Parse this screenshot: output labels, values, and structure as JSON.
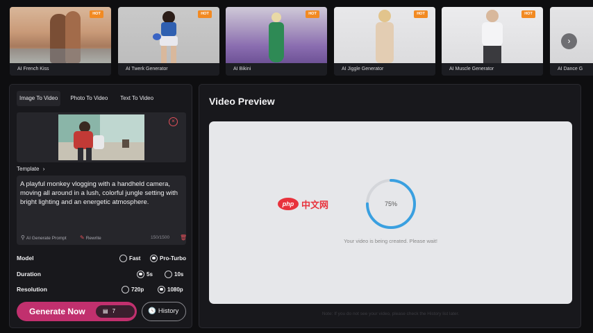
{
  "carousel": {
    "cards": [
      {
        "label": "AI French Kiss",
        "badge": "HOT"
      },
      {
        "label": "AI Twerk Generator",
        "badge": "HOT"
      },
      {
        "label": "AI Bikini",
        "badge": "HOT"
      },
      {
        "label": "AI Jiggle Generator",
        "badge": "HOT"
      },
      {
        "label": "AI Muscle Generator",
        "badge": "HOT"
      },
      {
        "label": "AI Dance G"
      }
    ],
    "next_icon": "chevron-right-icon"
  },
  "generator": {
    "tabs": [
      "Image To Video",
      "Photo To Video",
      "Text To Video"
    ],
    "active_tab": 0,
    "template_label": "Template",
    "prompt": "A playful monkey vlogging with a handheld camera, moving all around in a lush, colorful jungle setting with bright lighting and an energetic atmosphere.",
    "ai_prompt_label": "AI Generate Prompt",
    "rewrite_label": "Rewrite",
    "char_count": "150/1500",
    "model": {
      "label": "Model",
      "options": [
        "Fast",
        "Pro-Turbo"
      ],
      "selected": "Pro-Turbo"
    },
    "duration": {
      "label": "Duration",
      "options": [
        "5s",
        "10s"
      ],
      "selected": "5s"
    },
    "resolution": {
      "label": "Resolution",
      "options": [
        "720p",
        "1080p"
      ],
      "selected": "1080p"
    },
    "generate_label": "Generate Now",
    "credits": "7",
    "history_label": "History"
  },
  "preview": {
    "title": "Video Preview",
    "progress": 0.75,
    "progress_text": "75%",
    "status": "Your video is being created. Please wait!",
    "watermark_logo": "php",
    "watermark_text": "中文网",
    "footnote": "Note: If you do not see your video, please check the History list later."
  },
  "colors": {
    "accent": "#c1306e",
    "hot_badge": "#f28a22",
    "progress": "#3aa0e0",
    "danger": "#e2505a"
  }
}
